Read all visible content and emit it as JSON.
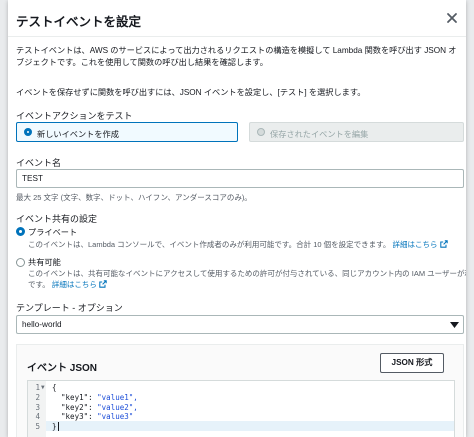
{
  "modal": {
    "title": "テストイベントを設定",
    "description": "テストイベントは、AWS のサービスによって出力されるリクエストの構造を模擬して Lambda 関数を呼び出す JSON オブジェクトです。これを使用して関数の呼び出し結果を確認します。",
    "instruction": "イベントを保存せずに関数を呼び出すには、JSON イベントを設定し、[テスト] を選択します。"
  },
  "event_action": {
    "label": "イベントアクションをテスト",
    "create_new": "新しいイベントを作成",
    "edit_saved": "保存されたイベントを編集",
    "selected": "create_new"
  },
  "event_name": {
    "label": "イベント名",
    "value": "TEST",
    "hint": "最大 25 文字 (文字、数字、ドット、ハイフン、アンダースコアのみ)。"
  },
  "sharing": {
    "label": "イベント共有の設定",
    "private_title": "プライベート",
    "private_desc": "このイベントは、Lambda コンソールで、イベント作成者のみが利用可能です。合計 10 個を設定できます。",
    "shareable_title": "共有可能",
    "shareable_desc": "このイベントは、共有可能なイベントにアクセスして使用するための許可が付与されている、同じアカウント内の IAM ユーザーが利用可能",
    "shareable_desc2": "です。",
    "link": "詳細はこちら",
    "selected": "private"
  },
  "template": {
    "label": "テンプレート - オプション",
    "value": "hello-world"
  },
  "event_json": {
    "title": "イベント JSON",
    "format_button": "JSON 形式",
    "lines": [
      {
        "n": "1",
        "code": "{"
      },
      {
        "n": "2",
        "key": "\"key1\"",
        "val": "\"value1\","
      },
      {
        "n": "3",
        "key": "\"key2\"",
        "val": "\"value2\","
      },
      {
        "n": "4",
        "key": "\"key3\"",
        "val": "\"value3\""
      },
      {
        "n": "5",
        "code": "}"
      }
    ]
  },
  "icons": [
    "close-icon",
    "external-link-icon",
    "caret-down-icon",
    "fold-arrow-icon"
  ],
  "colors": {
    "accent": "#0073bb",
    "disabled_bg": "#eaeded",
    "text": "#16191f"
  }
}
